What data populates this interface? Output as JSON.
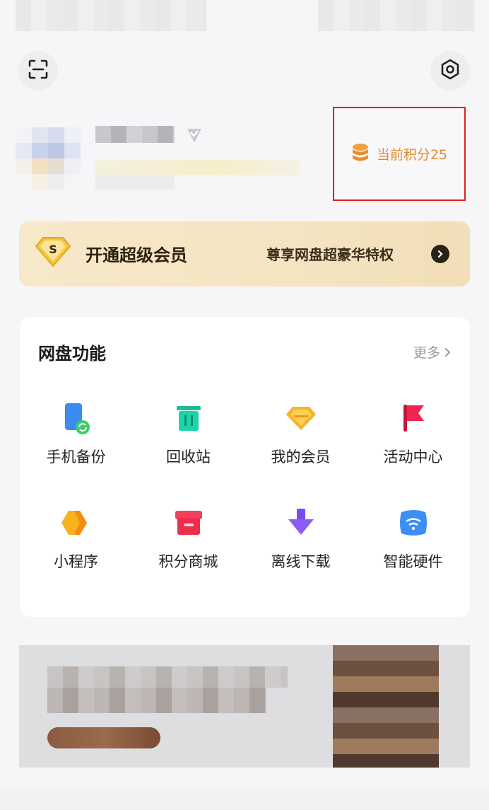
{
  "header": {
    "scan_icon": "scan-icon",
    "settings_icon": "settings-icon"
  },
  "points": {
    "label": "当前积分25",
    "icon": "coin-stack-icon",
    "color": "#e38a2d"
  },
  "vip": {
    "badge": "S",
    "title": "开通超级会员",
    "subtitle": "尊享网盘超豪华特权"
  },
  "functions": {
    "title": "网盘功能",
    "more_label": "更多",
    "items": [
      {
        "label": "手机备份",
        "icon": "phone-backup-icon"
      },
      {
        "label": "回收站",
        "icon": "trash-bin-icon"
      },
      {
        "label": "我的会员",
        "icon": "diamond-icon"
      },
      {
        "label": "活动中心",
        "icon": "flag-icon"
      },
      {
        "label": "小程序",
        "icon": "mini-program-icon"
      },
      {
        "label": "积分商城",
        "icon": "shop-icon"
      },
      {
        "label": "离线下载",
        "icon": "download-arrow-icon"
      },
      {
        "label": "智能硬件",
        "icon": "smart-hardware-icon"
      }
    ]
  }
}
